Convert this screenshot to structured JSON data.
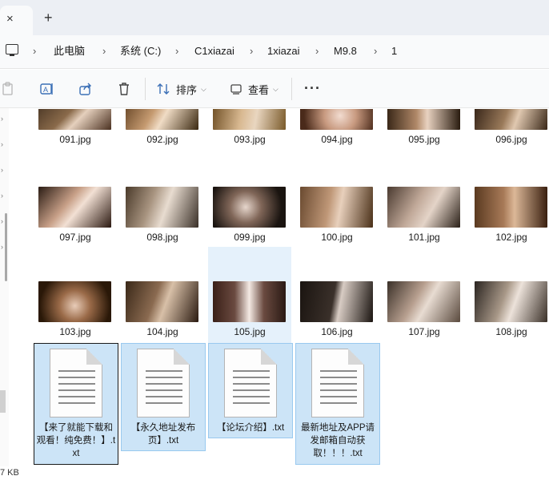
{
  "tabs": {
    "close_glyph": "×",
    "new_tab_glyph": "+"
  },
  "breadcrumb": {
    "separator": "›",
    "items": [
      "此电脑",
      "系统 (C:)",
      "C1xiazai",
      "1xiazai",
      "M9.8",
      "1"
    ]
  },
  "toolbar": {
    "sort_label": "排序",
    "view_label": "查看",
    "more_label": "···"
  },
  "files": {
    "row1": [
      "091.jpg",
      "092.jpg",
      "093.jpg",
      "094.jpg",
      "095.jpg",
      "096.jpg"
    ],
    "row2": [
      "097.jpg",
      "098.jpg",
      "099.jpg",
      "100.jpg",
      "101.jpg",
      "102.jpg"
    ],
    "row3": [
      "103.jpg",
      "104.jpg",
      "105.jpg",
      "106.jpg",
      "107.jpg",
      "108.jpg"
    ],
    "txt": [
      "【来了就能下载和观看！纯免费！】.txt",
      "【永久地址发布页】.txt",
      "【论坛介绍】.txt",
      "最新地址及APP请发邮箱自动获取！！！.txt"
    ]
  },
  "status": {
    "size_text": "7 KB"
  },
  "colors": {
    "selection": "#cce4f7",
    "selection_border": "#99c9ef",
    "accent": "#3b6fb6"
  }
}
